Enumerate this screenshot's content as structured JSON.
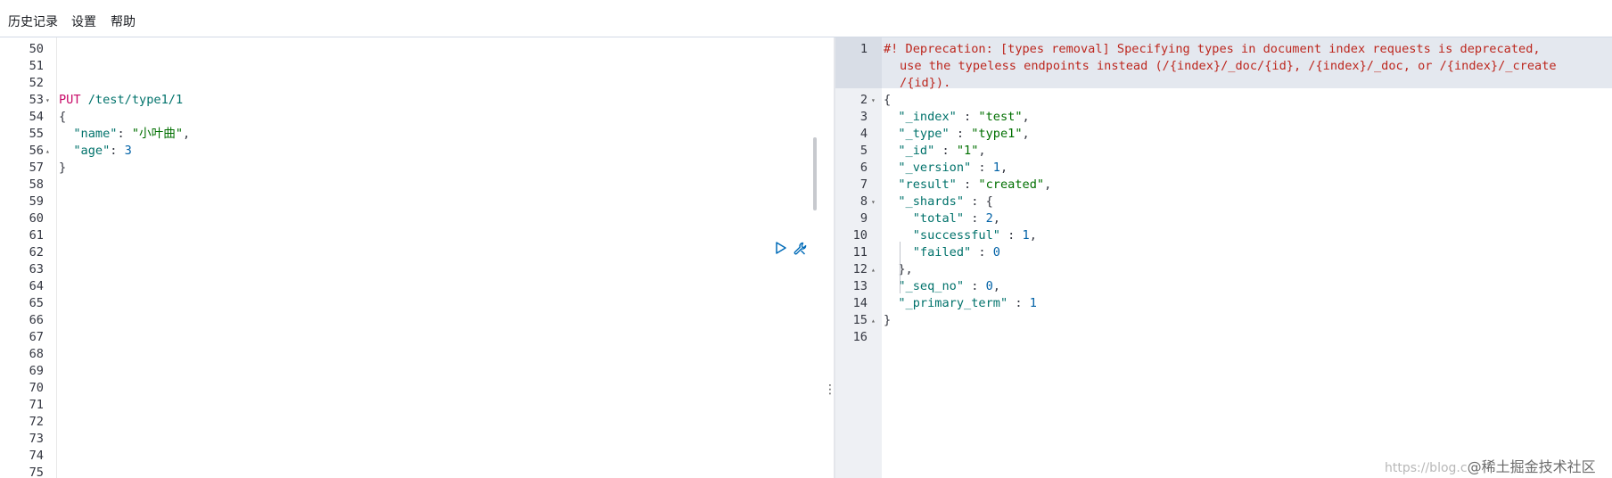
{
  "menu": {
    "history": "历史记录",
    "settings": "设置",
    "help": "帮助"
  },
  "editor": {
    "line_numbers": [
      "50",
      "51",
      "52",
      "53",
      "54",
      "55",
      "56",
      "57",
      "58",
      "59",
      "60",
      "61",
      "62",
      "63",
      "64",
      "65",
      "66",
      "67",
      "68",
      "69",
      "70",
      "71",
      "72",
      "73",
      "74",
      "75"
    ],
    "request_method": "PUT",
    "request_path": "/test/type1/1",
    "body": {
      "open_brace": "{",
      "name_key": "\"name\"",
      "name_value": "\"小叶曲\"",
      "age_key": "\"age\"",
      "age_value": "3",
      "close_brace": "}"
    }
  },
  "response": {
    "line_numbers": [
      "1",
      "2",
      "3",
      "4",
      "5",
      "6",
      "7",
      "8",
      "9",
      "10",
      "11",
      "12",
      "13",
      "14",
      "15",
      "16"
    ],
    "warning_line1": "#! Deprecation: [types removal] Specifying types in document index requests is deprecated,",
    "warning_line2": "use the typeless endpoints instead (/{index}/_doc/{id}, /{index}/_doc, or /{index}/_create",
    "warning_line3": "/{id}).",
    "index_key": "\"_index\"",
    "index_value": "\"test\"",
    "type_key": "\"_type\"",
    "type_value": "\"type1\"",
    "id_key": "\"_id\"",
    "id_value": "\"1\"",
    "version_key": "\"_version\"",
    "version_value": "1",
    "result_key": "\"result\"",
    "result_value": "\"created\"",
    "shards_key": "\"_shards\"",
    "total_key": "\"total\"",
    "total_value": "2",
    "successful_key": "\"successful\"",
    "successful_value": "1",
    "failed_key": "\"failed\"",
    "failed_value": "0",
    "seq_no_key": "\"_seq_no\"",
    "seq_no_value": "0",
    "primary_term_key": "\"_primary_term\"",
    "primary_term_value": "1"
  },
  "icons": {
    "run": "play-icon",
    "tools": "wrench-icon",
    "resize": "vertical-ellipsis-icon"
  },
  "watermark": {
    "url_text": "https://blog.c",
    "brand": "@稀土掘金技术社区"
  },
  "colors": {
    "method": "#c80a68",
    "key": "#00726b",
    "string": "#006f00",
    "number": "#0061a6",
    "warning": "#bd271e",
    "action_icon": "#006bb8"
  }
}
